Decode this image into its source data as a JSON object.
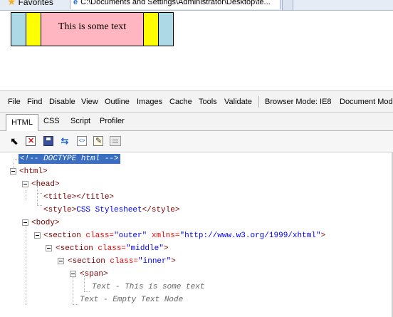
{
  "browser": {
    "favorites_label": "Favorites",
    "tab_title": "C:\\Documents and Settings\\Administrator\\Desktop\\te..."
  },
  "page": {
    "inner_text": "This is some text",
    "colors": {
      "outer": "#add8e6",
      "middle": "#ffff00",
      "inner": "#ffb6c1"
    }
  },
  "devtools": {
    "menu": [
      "File",
      "Find",
      "Disable",
      "View",
      "Outline",
      "Images",
      "Cache",
      "Tools",
      "Validate"
    ],
    "browser_mode": "Browser Mode: IE8",
    "document_mode": "Document Mode",
    "tabs": [
      "HTML",
      "CSS",
      "Script",
      "Profiler"
    ],
    "active_tab": "HTML",
    "tree": {
      "doctype": "<!-- DOCTYPE html -->",
      "html": "<html>",
      "head": "<head>",
      "title": "<title></title>",
      "style_open": "<style>",
      "style_text": "CSS Stylesheet",
      "style_close": "</style>",
      "body": "<body>",
      "section_outer": {
        "open": "<section",
        "attr1": "class=",
        "val1": "\"outer\"",
        "attr2": "xmlns=",
        "val2": "\"http://www.w3.org/1999/xhtml\"",
        "close": ">"
      },
      "section_middle": {
        "open": "<section",
        "attr": "class=",
        "val": "\"middle\"",
        "close": ">"
      },
      "section_inner": {
        "open": "<section",
        "attr": "class=",
        "val": "\"inner\"",
        "close": ">"
      },
      "span": "<span>",
      "text_node": "Text - This is some text",
      "empty_text_node": "Text - Empty Text Node"
    }
  }
}
